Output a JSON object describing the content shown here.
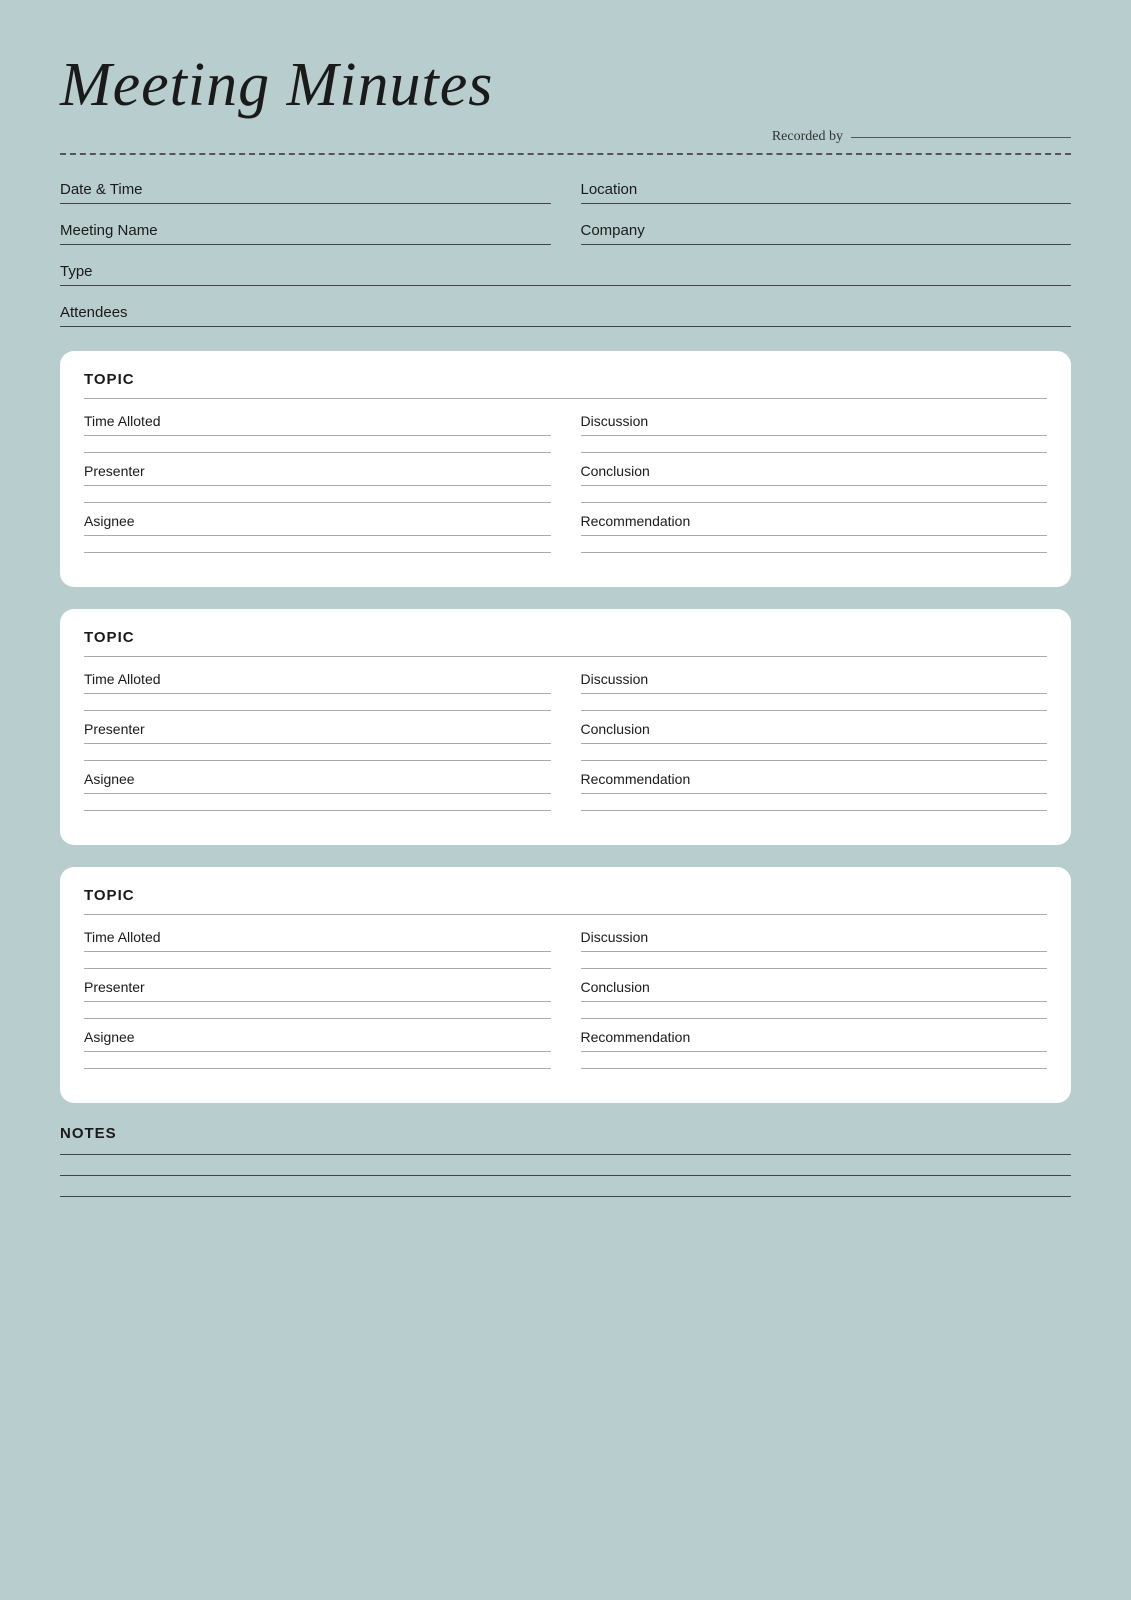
{
  "title": "Meeting Minutes",
  "recorded_by_label": "Recorded by",
  "header": {
    "fields": [
      {
        "label": "Date & Time",
        "col": "left"
      },
      {
        "label": "Location",
        "col": "right"
      },
      {
        "label": "Meeting Name",
        "col": "left"
      },
      {
        "label": "Company",
        "col": "right"
      },
      {
        "label": "Type",
        "col": "full"
      },
      {
        "label": "Attendees",
        "col": "full"
      }
    ]
  },
  "topics": [
    {
      "header": "TOPIC",
      "left_fields": [
        {
          "label": "Time Alloted"
        },
        {
          "label": "Presenter"
        },
        {
          "label": "Asignee"
        }
      ],
      "right_fields": [
        {
          "label": "Discussion"
        },
        {
          "label": "Conclusion"
        },
        {
          "label": "Recommendation"
        }
      ]
    },
    {
      "header": "TOPIC",
      "left_fields": [
        {
          "label": "Time Alloted"
        },
        {
          "label": "Presenter"
        },
        {
          "label": "Asignee"
        }
      ],
      "right_fields": [
        {
          "label": "Discussion"
        },
        {
          "label": "Conclusion"
        },
        {
          "label": "Recommendation"
        }
      ]
    },
    {
      "header": "TOPIC",
      "left_fields": [
        {
          "label": "Time Alloted"
        },
        {
          "label": "Presenter"
        },
        {
          "label": "Asignee"
        }
      ],
      "right_fields": [
        {
          "label": "Discussion"
        },
        {
          "label": "Conclusion"
        },
        {
          "label": "Recommendation"
        }
      ]
    }
  ],
  "notes": {
    "label": "NOTES"
  }
}
